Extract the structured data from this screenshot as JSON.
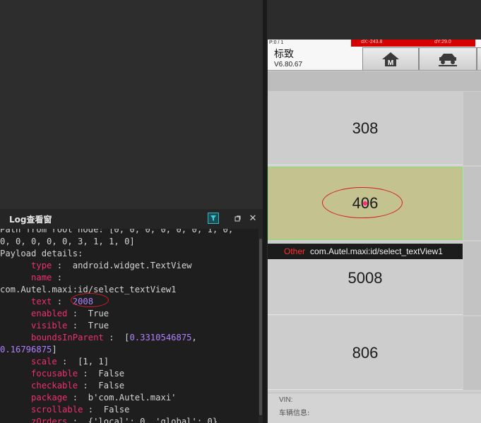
{
  "log_panel": {
    "title": "Log查看窗",
    "icons": [
      "filter-icon",
      "maximize-icon",
      "close-icon"
    ],
    "lines": [
      [
        {
          "t": "Path from root node: [0, 0, 0, 0, 0, 0, 1, 0,",
          "c": ""
        }
      ],
      [
        {
          "t": "0, 0, 0, 0, 0, 3, 1, 1, 0]",
          "c": ""
        }
      ],
      [
        {
          "t": "Payload details:",
          "c": ""
        }
      ],
      [
        {
          "t": "      ",
          "c": ""
        },
        {
          "t": "type",
          "c": "k"
        },
        {
          "t": " :  android.widget.TextView",
          "c": ""
        }
      ],
      [
        {
          "t": "      ",
          "c": ""
        },
        {
          "t": "name",
          "c": "k"
        },
        {
          "t": " :",
          "c": ""
        }
      ],
      [
        {
          "t": "com.Autel.maxi:id/select_textView1",
          "c": ""
        }
      ],
      [
        {
          "t": "      ",
          "c": ""
        },
        {
          "t": "text",
          "c": "k"
        },
        {
          "t": " :  ",
          "c": ""
        },
        {
          "t": "2008",
          "c": "n"
        }
      ],
      [
        {
          "t": "      ",
          "c": ""
        },
        {
          "t": "enabled",
          "c": "k"
        },
        {
          "t": " :  True",
          "c": ""
        }
      ],
      [
        {
          "t": "      ",
          "c": ""
        },
        {
          "t": "visible",
          "c": "k"
        },
        {
          "t": " :  True",
          "c": ""
        }
      ],
      [
        {
          "t": "      ",
          "c": ""
        },
        {
          "t": "boundsInParent",
          "c": "k"
        },
        {
          "t": " :  [",
          "c": ""
        },
        {
          "t": "0.3310546875",
          "c": "n"
        },
        {
          "t": ",",
          "c": ""
        }
      ],
      [
        {
          "t": "0.16796875",
          "c": "n"
        },
        {
          "t": "]",
          "c": ""
        }
      ],
      [
        {
          "t": "      ",
          "c": ""
        },
        {
          "t": "scale",
          "c": "k"
        },
        {
          "t": " :  [1, 1]",
          "c": ""
        }
      ],
      [
        {
          "t": "      ",
          "c": ""
        },
        {
          "t": "focusable",
          "c": "k"
        },
        {
          "t": " :  False",
          "c": ""
        }
      ],
      [
        {
          "t": "      ",
          "c": ""
        },
        {
          "t": "checkable",
          "c": "k"
        },
        {
          "t": " :  False",
          "c": ""
        }
      ],
      [
        {
          "t": "      ",
          "c": ""
        },
        {
          "t": "package",
          "c": "k"
        },
        {
          "t": " :  b'com.Autel.maxi'",
          "c": ""
        }
      ],
      [
        {
          "t": "      ",
          "c": ""
        },
        {
          "t": "scrollable",
          "c": "k"
        },
        {
          "t": " :  False",
          "c": ""
        }
      ],
      [
        {
          "t": "      ",
          "c": ""
        },
        {
          "t": "zOrders",
          "c": "k"
        },
        {
          "t": " :  {'local': 0, 'global': 0}",
          "c": ""
        }
      ]
    ]
  },
  "device": {
    "pointer_info": "P:0 / 1",
    "dx": "dX:-243.8",
    "dy": "dY:29.0",
    "brand": "标致",
    "version": "V6.80.67",
    "tabs": [
      {
        "name": "home-icon",
        "label": "M"
      },
      {
        "name": "car-lift-icon"
      }
    ],
    "items": [
      "308",
      "406",
      "5008",
      "806"
    ],
    "selected_index": 1,
    "tooltip": {
      "label": "Other",
      "value": "com.Autel.maxi:id/select_textView1"
    },
    "footer": {
      "vin_label": "VIN:",
      "vehicle_label": "车辆信息:"
    }
  },
  "colors": {
    "accent_red": "#d21d1d",
    "selected_item_bg": "#c4c38f",
    "keyword": "#f0306d",
    "number": "#ae81ff"
  }
}
